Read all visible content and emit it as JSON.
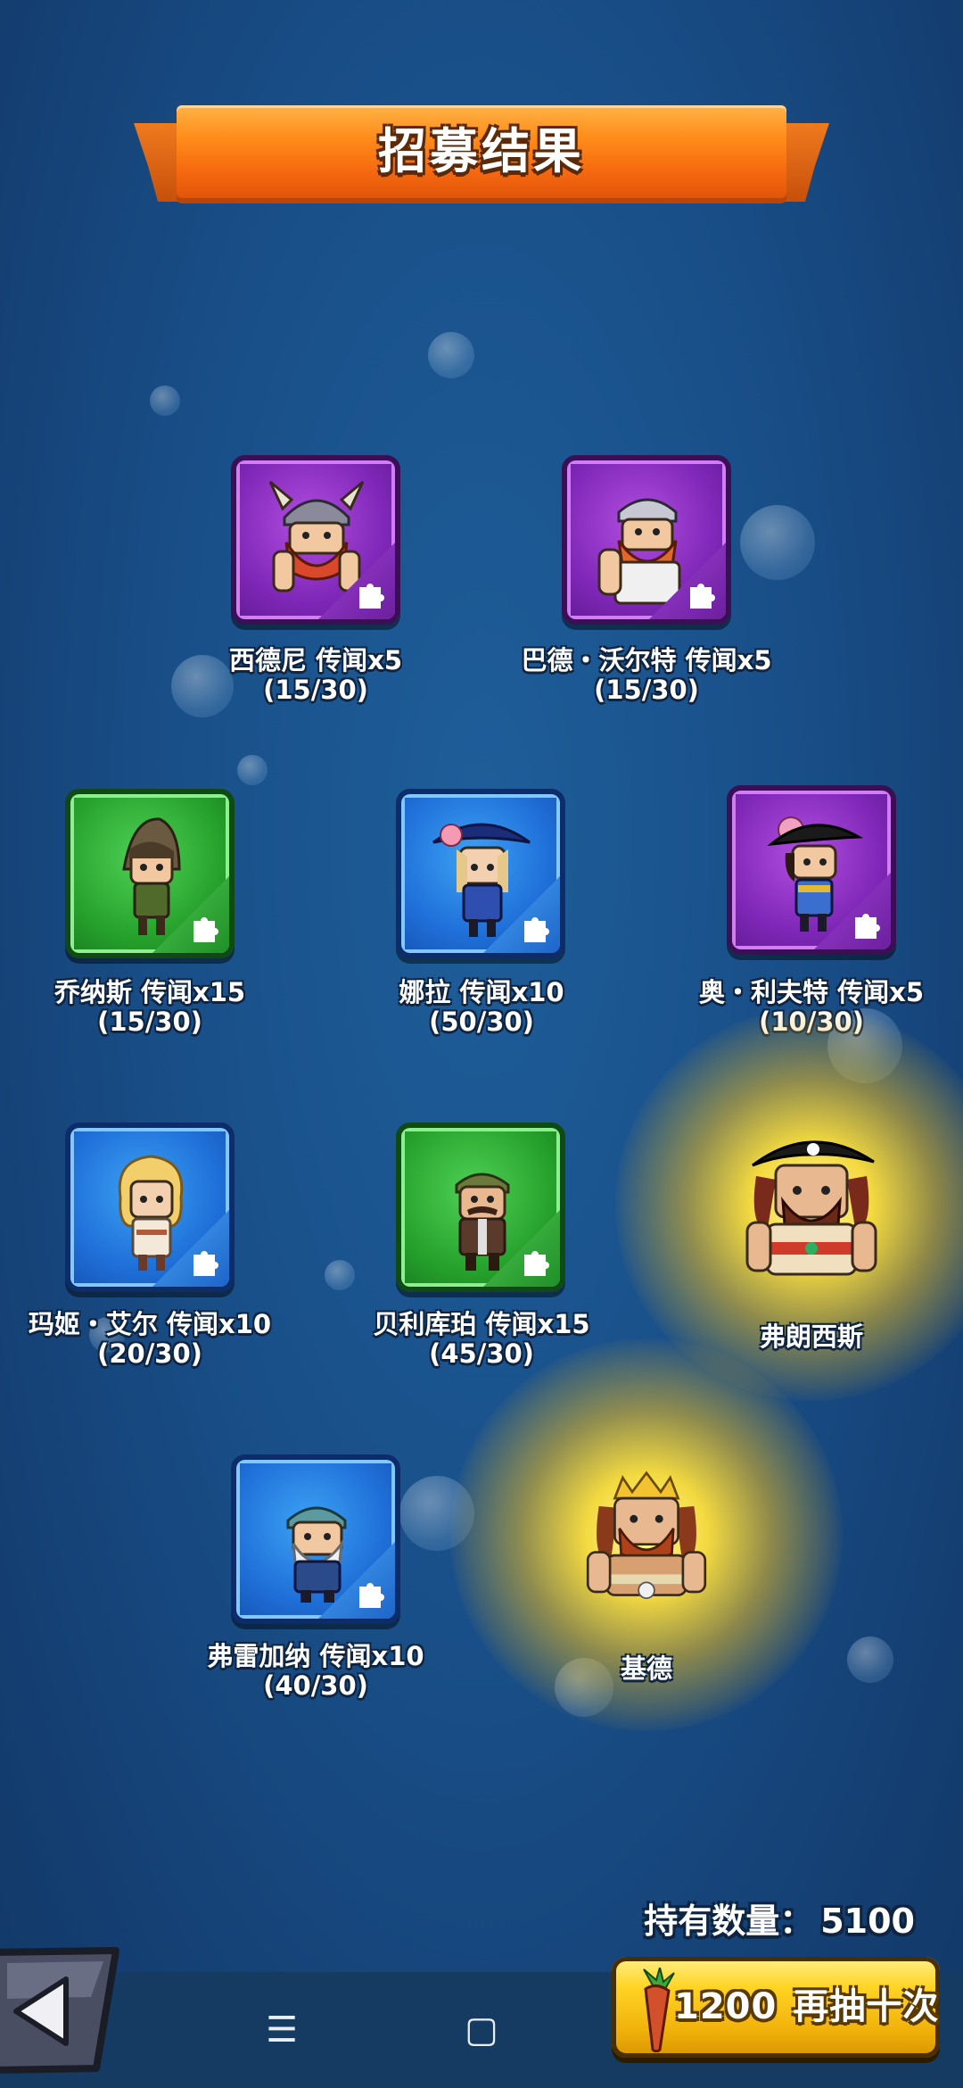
{
  "title": "招募结果",
  "cards": [
    {
      "name": "西德尼",
      "reward": "传闻x5",
      "progress": "(15/30)",
      "rarity": "purple"
    },
    {
      "name": "巴德・沃尔特",
      "reward": "传闻x5",
      "progress": "(15/30)",
      "rarity": "purple"
    },
    {
      "name": "乔纳斯",
      "reward": "传闻x15",
      "progress": "(15/30)",
      "rarity": "green"
    },
    {
      "name": "娜拉",
      "reward": "传闻x10",
      "progress": "(50/30)",
      "rarity": "blue"
    },
    {
      "name": "奥・利夫特",
      "reward": "传闻x5",
      "progress": "(10/30)",
      "rarity": "purple"
    },
    {
      "name": "玛姬・艾尔",
      "reward": "传闻x10",
      "progress": "(20/30)",
      "rarity": "blue"
    },
    {
      "name": "贝利库珀",
      "reward": "传闻x15",
      "progress": "(45/30)",
      "rarity": "green"
    },
    {
      "name": "弗雷加纳",
      "reward": "传闻x10",
      "progress": "(40/30)",
      "rarity": "blue"
    }
  ],
  "heroes": [
    {
      "name": "弗朗西斯"
    },
    {
      "name": "基德"
    }
  ],
  "holdings": {
    "label": "持有数量：",
    "value": "5100"
  },
  "draw_button": {
    "cost": "1200",
    "label": "再抽十次"
  },
  "colors": {
    "background": "#194f88",
    "banner": "#f76a10",
    "purple": "#7f27b8",
    "green": "#27a32d",
    "blue": "#1f6fd8",
    "button": "#ffd423"
  },
  "icons": {
    "piece": "puzzle-piece-icon",
    "back": "back-arrow-icon",
    "currency": "carrot-icon",
    "nav": [
      "menu-icon",
      "home-square-icon",
      "back-chevron-icon"
    ]
  }
}
